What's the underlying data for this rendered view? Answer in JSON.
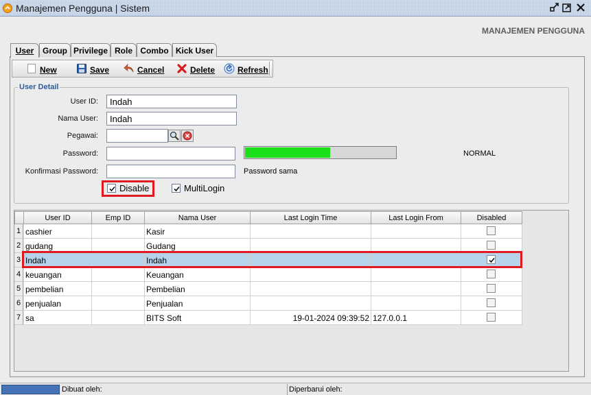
{
  "window": {
    "title": "Manajemen Pengguna | Sistem"
  },
  "module_title": "MANAJEMEN PENGGUNA",
  "tabs": [
    {
      "label": "User"
    },
    {
      "label": "Group"
    },
    {
      "label": "Privilege"
    },
    {
      "label": "Role"
    },
    {
      "label": "Combo"
    },
    {
      "label": "Kick User"
    }
  ],
  "toolbar": {
    "new": "New",
    "save": "Save",
    "cancel": "Cancel",
    "delete": "Delete",
    "refresh": "Refresh"
  },
  "user_detail": {
    "title": "User Detail",
    "user_id_label": "User ID:",
    "user_id": "Indah",
    "nama_user_label": "Nama User:",
    "nama_user": "Indah",
    "pegawai_label": "Pegawai:",
    "pegawai": "",
    "password_label": "Password:",
    "password": "",
    "strength_level": 0.56,
    "strength_color": "#1bdf1b",
    "strength_text": "NORMAL",
    "konfirmasi_label": "Konfirmasi Password:",
    "konfirmasi": "",
    "match_text": "Password sama",
    "disable_label": "Disable",
    "disable_checked": true,
    "multilogin_label": "MultiLogin",
    "multilogin_checked": true
  },
  "grid": {
    "columns": [
      "User ID",
      "Emp ID",
      "Nama User",
      "Last Login Time",
      "Last Login From",
      "Disabled"
    ],
    "rows": [
      {
        "num": "1",
        "user_id": "cashier",
        "emp_id": "",
        "nama": "Kasir",
        "time": "",
        "from": "",
        "disabled": false
      },
      {
        "num": "2",
        "user_id": "gudang",
        "emp_id": "",
        "nama": "Gudang",
        "time": "",
        "from": "",
        "disabled": false
      },
      {
        "num": "3",
        "user_id": "Indah",
        "emp_id": "",
        "nama": "Indah",
        "time": "",
        "from": "",
        "disabled": true
      },
      {
        "num": "4",
        "user_id": "keuangan",
        "emp_id": "",
        "nama": "Keuangan",
        "time": "",
        "from": "",
        "disabled": false
      },
      {
        "num": "5",
        "user_id": "pembelian",
        "emp_id": "",
        "nama": "Pembelian",
        "time": "",
        "from": "",
        "disabled": false
      },
      {
        "num": "6",
        "user_id": "penjualan",
        "emp_id": "",
        "nama": "Penjualan",
        "time": "",
        "from": "",
        "disabled": false
      },
      {
        "num": "7",
        "user_id": "sa",
        "emp_id": "",
        "nama": "BITS Soft",
        "time": "19-01-2024 09:39:52",
        "from": "127.0.0.1",
        "disabled": false
      }
    ],
    "selected_row": 2
  },
  "statusbar": {
    "created_by": "Dibuat oleh:",
    "updated_by": "Diperbarui oleh:"
  },
  "colors": {
    "highlight": "#e0181f",
    "selection": "#b7d3ec",
    "accent": "#2f5b9c"
  }
}
